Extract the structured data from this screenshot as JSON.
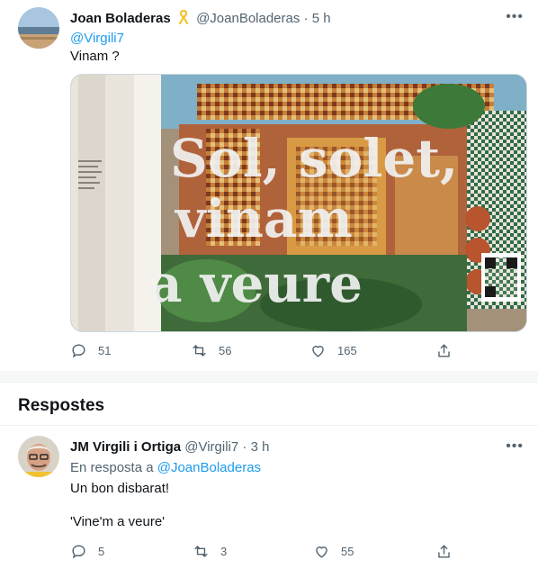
{
  "tweet": {
    "author_name": "Joan Boladeras",
    "badge_icon": "yellow-ribbon-icon",
    "handle": "@JoanBoladeras",
    "time": "· 5 h",
    "mention": "@Virgili7",
    "text": "Vinam ?",
    "image": {
      "line1": "Sol, solet,",
      "line2": "vinam",
      "line3": "a veure"
    },
    "actions": {
      "replies": "51",
      "retweets": "56",
      "likes": "165"
    }
  },
  "replies_header": "Respostes",
  "reply": {
    "author_name": "JM Virgili i Ortiga",
    "handle": "@Virgili7",
    "time": "· 3 h",
    "in_reply_prefix": "En resposta a",
    "in_reply_handle": "@JoanBoladeras",
    "line1": "Un bon disbarat!",
    "line2": "'Vine'm a veure'",
    "actions": {
      "replies": "5",
      "retweets": "3",
      "likes": "55"
    }
  },
  "colors": {
    "accent": "#1d9bf0",
    "muted": "#536471",
    "ribbon": "#f4c430"
  }
}
